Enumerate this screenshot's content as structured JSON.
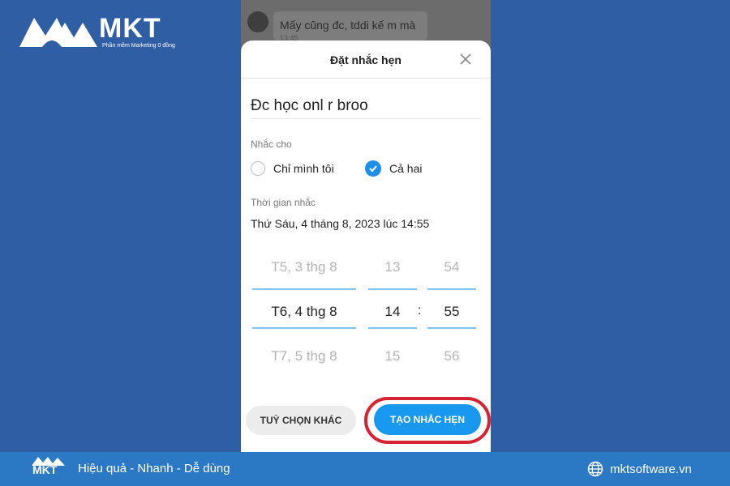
{
  "brand": {
    "name": "MKT",
    "tagline": "Phần mềm Marketing 0 đồng"
  },
  "chat": {
    "message": "Mấy cũng đc, tddi kế m mà",
    "time": "13:45"
  },
  "dialog": {
    "title": "Đặt nhắc hẹn",
    "reminder_text": "Đc học onl r broo",
    "remind_for_label": "Nhắc cho",
    "options": [
      {
        "label": "Chỉ mình tôi",
        "checked": false
      },
      {
        "label": "Cả hai",
        "checked": true
      }
    ],
    "time_label": "Thời gian nhắc",
    "selected_datetime": "Thứ Sáu, 4 tháng 8, 2023 lúc 14:55",
    "picker": {
      "dates": [
        "T5, 3 thg 8",
        "T6, 4 thg 8",
        "T7, 5 thg 8"
      ],
      "hours": [
        "13",
        "14",
        "15"
      ],
      "minutes": [
        "54",
        "55",
        "56"
      ],
      "separator": ":"
    },
    "buttons": {
      "other": "TUỲ CHỌN KHÁC",
      "create": "TẠO NHẮC HẸN"
    }
  },
  "footer": {
    "slogan": "Hiệu quả - Nhanh - Dễ dùng",
    "website": "mktsoftware.vn",
    "logo_text": "MKT"
  },
  "colors": {
    "background": "#2f5ea4",
    "footer": "#2b78c5",
    "accent_blue": "#1898ee",
    "highlight_red": "#d42434"
  }
}
